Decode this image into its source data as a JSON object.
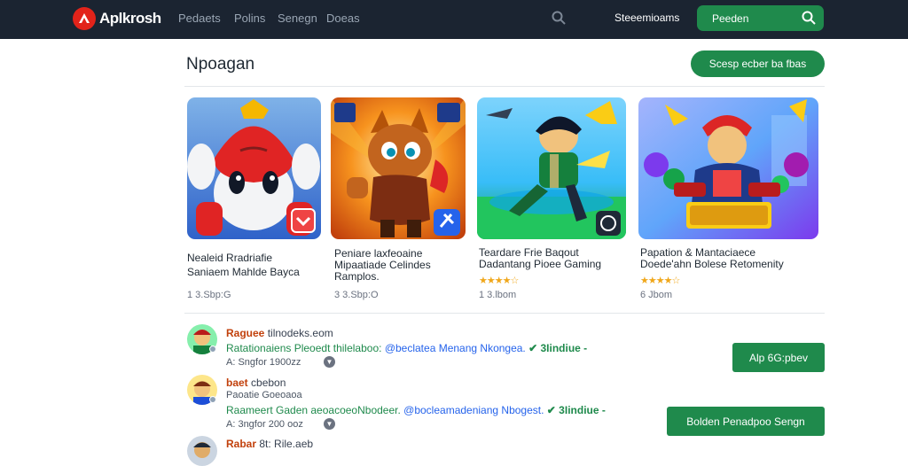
{
  "header": {
    "logo_text": "Aplkrosh",
    "nav": [
      "Pedaets",
      "Polins",
      "Senegn",
      "Doeas"
    ],
    "account_link": "Steeemioams",
    "search_button": "Peeden"
  },
  "section": {
    "title": "Npoagan",
    "see_all_button": "Scesp ecber ba fbas"
  },
  "games": [
    {
      "title_line1": "Nealeid Rradriafie",
      "title_line2": "Saniaem Mahlde Bayca",
      "title_line3": "",
      "meta": "1 3.Sbp:G",
      "rating": ""
    },
    {
      "title_line1": "Peniare laxfeoaine",
      "title_line2": "Mipaatiade Celindes",
      "title_line3": "Ramplos.",
      "meta": "3 3.Sbp:O",
      "rating": ""
    },
    {
      "title_line1": "Teardare Frie Baqout",
      "title_line2": "Dadantang Pioee Gaming",
      "title_line3": "",
      "meta": "1 3.lbom",
      "rating": "★★★★☆"
    },
    {
      "title_line1": "Papation & Mantaciaece",
      "title_line2": "Doede'ahn Bolese Retomenity",
      "title_line3": "",
      "meta": "6 Jbom",
      "rating": "★★★★☆"
    }
  ],
  "reviews": [
    {
      "name": "Raguee",
      "handle": "tilnodeks.eom",
      "line_pre": "Ratationaiens Pleoedt thilelaboo:",
      "line_link": "@beclatea Menang Nkongea.",
      "line_post": "✔ 3Iindiue -",
      "meta": "A: Sngfor 1900zz"
    },
    {
      "name": "baet",
      "handle": "cbebon",
      "line2": "Paoatie Goeoaoa",
      "line_pre": "Raameert Gaden aeoacoeoNbodeer.",
      "line_link": "@bocleamadeniang Nbogest.",
      "line_post": "✔ 3Iindiue -",
      "meta": "A: 3ngfor 200 ooz"
    },
    {
      "name": "Rabar",
      "handle": "8t: Rile.aeb",
      "line_pre": "",
      "line_link": "",
      "line_post": "",
      "meta": ""
    }
  ],
  "actions": {
    "follow_button": "Alp 6G:pbev",
    "secondary_button": "Bolden Penadpoo Sengn"
  },
  "icons": [
    "search-icon",
    "chevron-down-icon"
  ],
  "colors": {
    "topbar": "#1b2431",
    "brand": "#e2231a",
    "accent": "#1f8a4c"
  }
}
